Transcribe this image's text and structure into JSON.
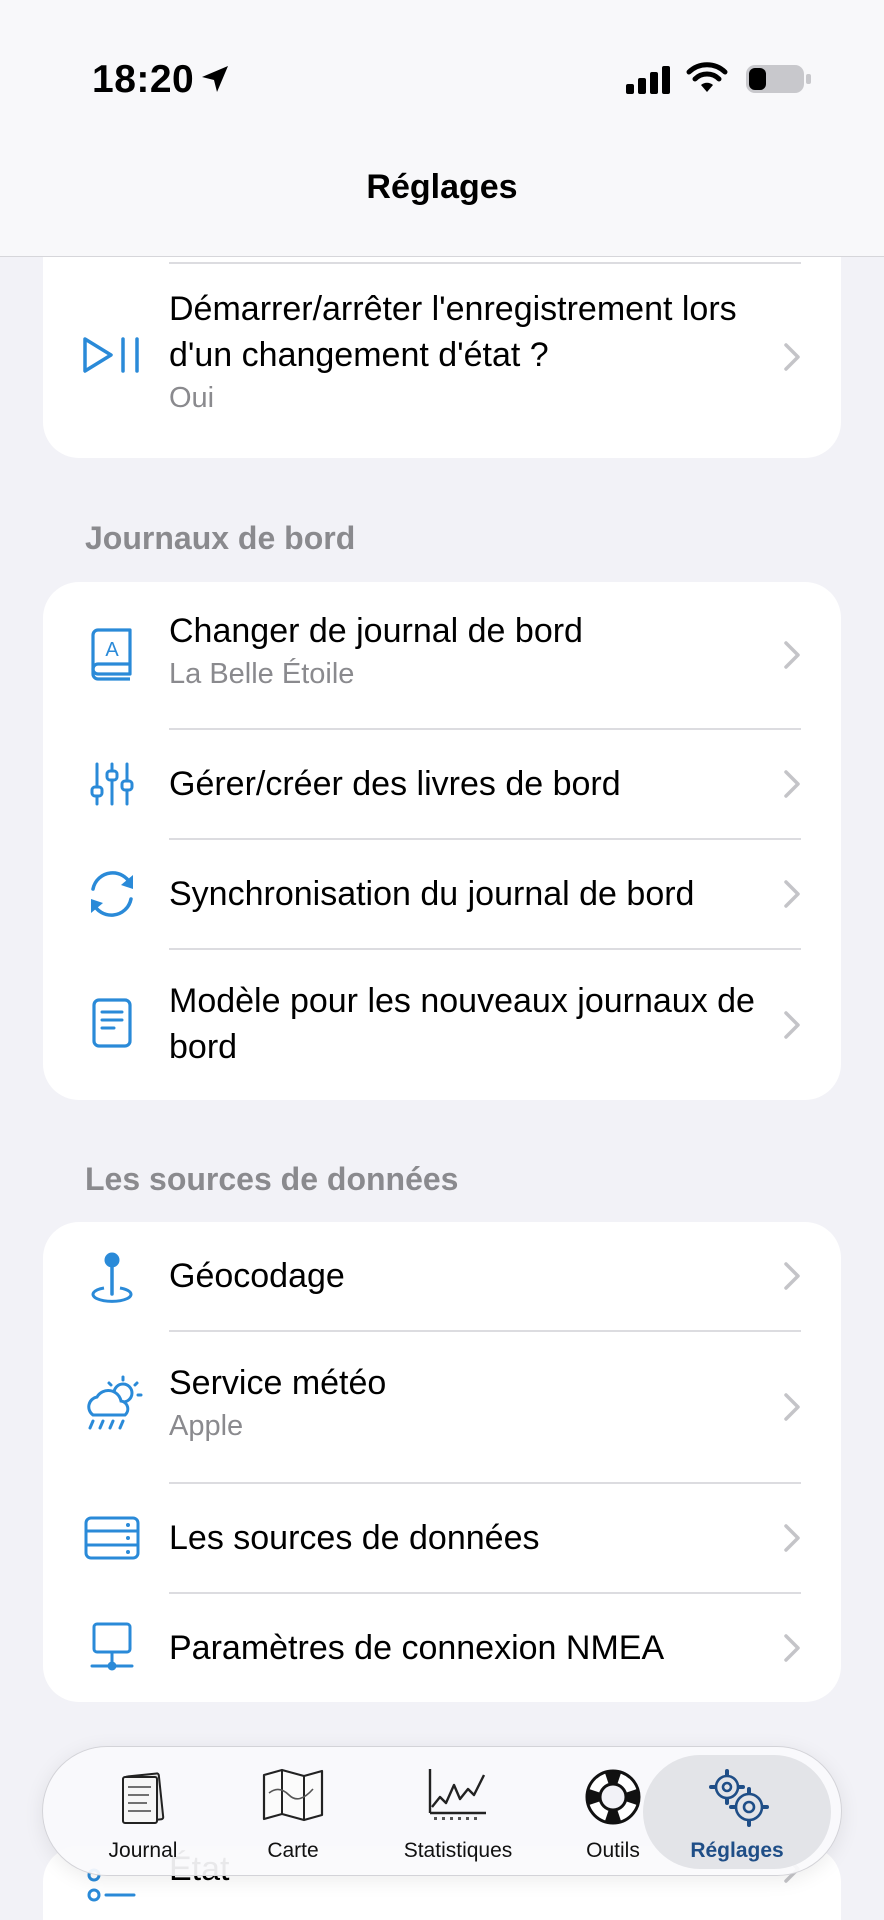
{
  "status_bar": {
    "time": "18:20"
  },
  "nav": {
    "title": "Réglages"
  },
  "top_card": {
    "item": {
      "title": "Démarrer/arrêter l'enregistrement lors d'un changement d'état ?",
      "subtitle": "Oui",
      "icon": "play-pause-icon"
    }
  },
  "sections": [
    {
      "header": "Journaux de bord",
      "items": [
        {
          "title": "Changer de journal de bord",
          "subtitle": "La Belle Étoile",
          "icon": "book-icon"
        },
        {
          "title": "Gérer/créer des livres de bord",
          "subtitle": "",
          "icon": "sliders-icon"
        },
        {
          "title": "Synchronisation du journal de bord",
          "subtitle": "",
          "icon": "sync-icon"
        },
        {
          "title": "Modèle pour les nouveaux journaux de bord",
          "subtitle": "",
          "icon": "document-icon"
        }
      ]
    },
    {
      "header": "Les sources de données",
      "items": [
        {
          "title": "Géocodage",
          "subtitle": "",
          "icon": "pin-icon"
        },
        {
          "title": "Service météo",
          "subtitle": "Apple",
          "icon": "weather-icon"
        },
        {
          "title": "Les sources de données",
          "subtitle": "",
          "icon": "server-icon"
        },
        {
          "title": "Paramètres de connexion NMEA",
          "subtitle": "",
          "icon": "network-icon"
        }
      ]
    }
  ],
  "behind_tabbar": {
    "item_title": "État"
  },
  "tabbar": {
    "tabs": [
      {
        "label": "Journal",
        "icon": "journal-tab-icon",
        "active": false
      },
      {
        "label": "Carte",
        "icon": "map-tab-icon",
        "active": false
      },
      {
        "label": "Statistiques",
        "icon": "stats-tab-icon",
        "active": false
      },
      {
        "label": "Outils",
        "icon": "lifebuoy-tab-icon",
        "active": false
      },
      {
        "label": "Réglages",
        "icon": "gears-tab-icon",
        "active": true
      }
    ]
  },
  "colors": {
    "accent": "#2a8ad8",
    "active_tab": "#1f4e87",
    "background": "#f2f2f7"
  }
}
